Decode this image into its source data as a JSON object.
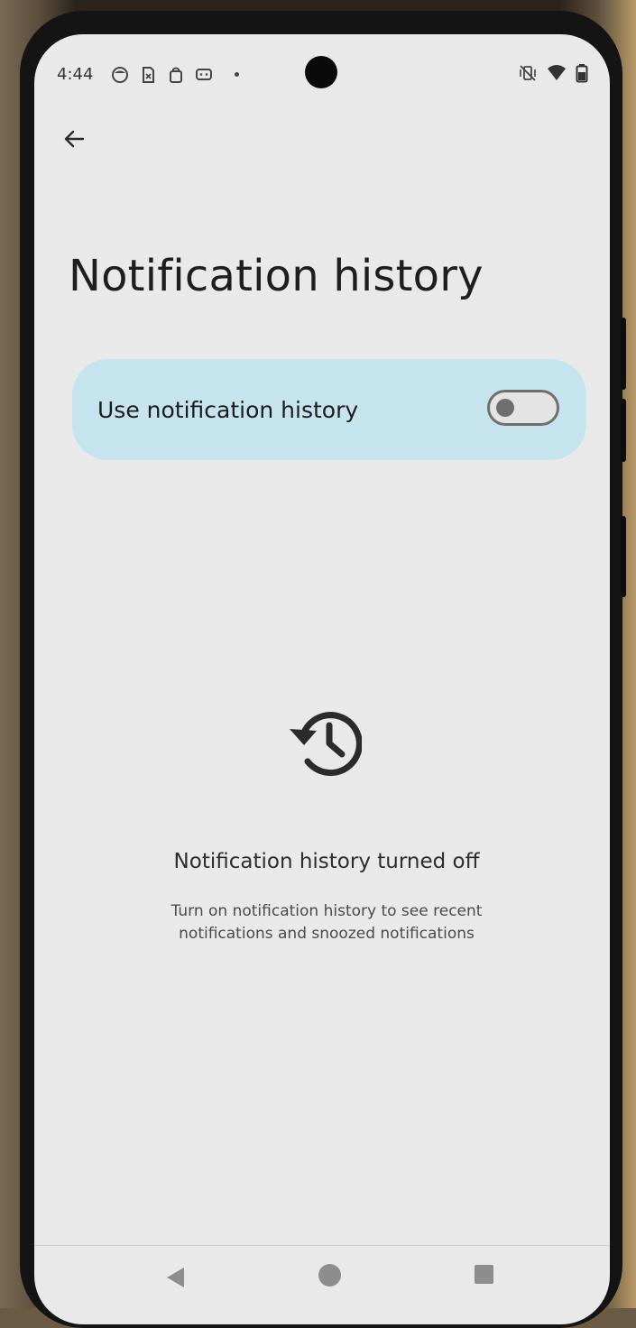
{
  "status_bar": {
    "time": "4:44",
    "left_icons": [
      "smiley-icon",
      "sim-card-icon",
      "shopping-bag-icon",
      "chat-icon"
    ],
    "right_icons": [
      "vibrate-off-icon",
      "wifi-icon",
      "battery-icon"
    ]
  },
  "header": {
    "back_icon": "arrow-back-icon",
    "title": "Notification history"
  },
  "setting": {
    "label": "Use notification history",
    "toggle_on": false,
    "card_color": "#c6e4ee"
  },
  "empty_state": {
    "icon": "history-icon",
    "title": "Notification history turned off",
    "description": "Turn on notification history to see recent notifications and snoozed notifications"
  },
  "nav_bar": {
    "buttons": [
      "nav-back-icon",
      "nav-home-icon",
      "nav-recents-icon"
    ]
  }
}
